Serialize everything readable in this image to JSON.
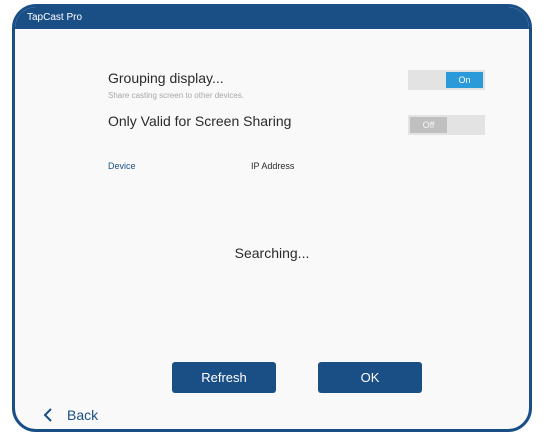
{
  "titlebar": {
    "title": "TapCast Pro"
  },
  "grouping": {
    "title": "Grouping display...",
    "subtitle": "Share casting screen to other devices.",
    "toggle_label": "On"
  },
  "screen_sharing": {
    "title": "Only Valid for Screen Sharing",
    "toggle_label": "Off"
  },
  "table": {
    "columns": [
      "Device",
      "IP Address"
    ],
    "status": "Searching..."
  },
  "buttons": {
    "refresh": "Refresh",
    "ok": "OK"
  },
  "nav": {
    "back": "Back",
    "back_icon": "chevron-left-icon"
  },
  "colors": {
    "brand": "#1a4f86",
    "toggle_on": "#2a9ad8",
    "device_header": "#1a4f86"
  }
}
